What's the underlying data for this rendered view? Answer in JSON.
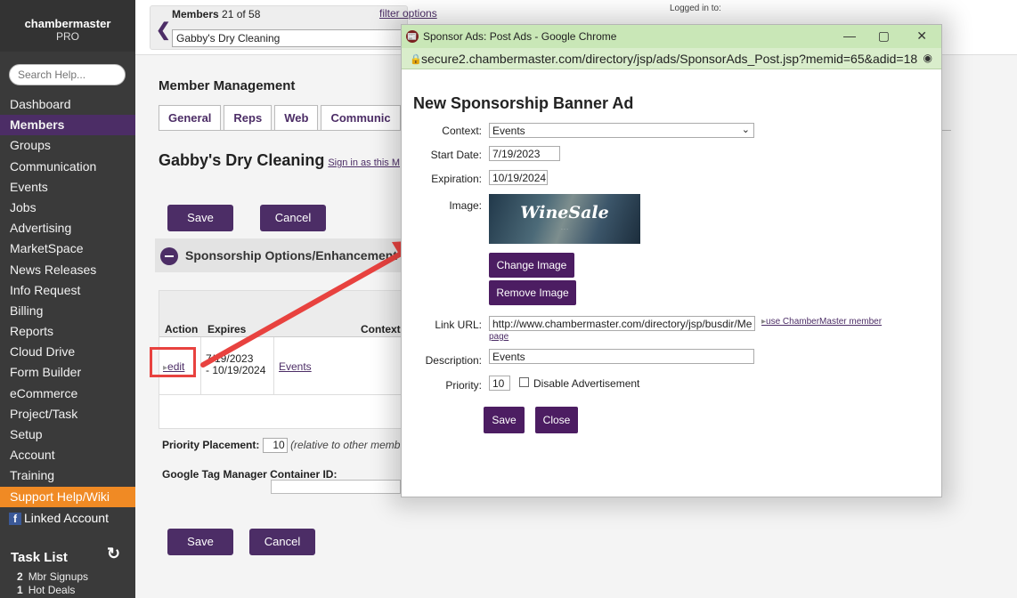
{
  "sidebar": {
    "logo_line1": "chambermaster",
    "logo_line2": "PRO",
    "search_placeholder": "Search Help...",
    "items": [
      {
        "label": "Dashboard"
      },
      {
        "label": "Members"
      },
      {
        "label": "Groups"
      },
      {
        "label": "Communication"
      },
      {
        "label": "Events"
      },
      {
        "label": "Jobs"
      },
      {
        "label": "Advertising"
      },
      {
        "label": "MarketSpace"
      },
      {
        "label": "News Releases"
      },
      {
        "label": "Info Request"
      },
      {
        "label": "Billing"
      },
      {
        "label": "Reports"
      },
      {
        "label": "Cloud Drive"
      },
      {
        "label": "Form Builder"
      },
      {
        "label": "eCommerce"
      },
      {
        "label": "Project/Task"
      },
      {
        "label": "Setup"
      },
      {
        "label": "Account"
      },
      {
        "label": "Training"
      },
      {
        "label": "Support Help/Wiki"
      }
    ],
    "linked_account": "Linked Account",
    "task_list": "Task List",
    "tasks": [
      {
        "count": "2",
        "label": "Mbr Signups"
      },
      {
        "count": "1",
        "label": "Hot Deals"
      }
    ]
  },
  "topbar": {
    "members_label": "Members",
    "members_count": "21 of 58",
    "member_name": "Gabby's Dry Cleaning",
    "filter_options": "filter options",
    "logged_in": "Logged in to:"
  },
  "main": {
    "title": "Member Management",
    "tabs": [
      "General",
      "Reps",
      "Web",
      "Communic"
    ],
    "page_title": "Gabby's Dry Cleaning",
    "sign_in_link": "Sign in as this M",
    "save_label": "Save",
    "cancel_label": "Cancel",
    "section_title": "Sponsorship Options/Enhancement",
    "table": {
      "headers": [
        "Action",
        "Expires",
        "Context"
      ],
      "row": {
        "action": "edit",
        "expires_line1": "7/19/2023",
        "expires_line2": "- 10/19/2024",
        "context": "Events"
      }
    },
    "priority_label": "Priority Placement:",
    "priority_value": "10",
    "priority_note": "(relative to other memb",
    "gtm_label": "Google Tag Manager Container ID:"
  },
  "popup": {
    "window_title": "Sponsor Ads: Post Ads - Google Chrome",
    "url": "secure2.chambermaster.com/directory/jsp/ads/SponsorAds_Post.jsp?memid=65&adid=18",
    "heading": "New Sponsorship Banner Ad",
    "context_label": "Context:",
    "context_value": "Events",
    "start_label": "Start Date:",
    "start_value": "7/19/2023",
    "expiration_label": "Expiration:",
    "expiration_value": "10/19/2024",
    "image_label": "Image:",
    "image_text": "WineSale",
    "change_image": "Change Image",
    "remove_image": "Remove Image",
    "link_label": "Link URL:",
    "link_value": "http://www.chambermaster.com/directory/jsp/busdir/Me",
    "use_member_link": "use ChamberMaster member",
    "page_link": "page",
    "description_label": "Description:",
    "description_value": "Events",
    "priority_label": "Priority:",
    "priority_value": "10",
    "disable_label": "Disable Advertisement",
    "save_label": "Save",
    "close_label": "Close"
  },
  "colors": {
    "purple": "#4c2d66",
    "orange": "#f08a24",
    "sidebar": "#3a3a3a",
    "annotation_red": "#e8423f",
    "chrome_green": "#c9e7b7"
  }
}
